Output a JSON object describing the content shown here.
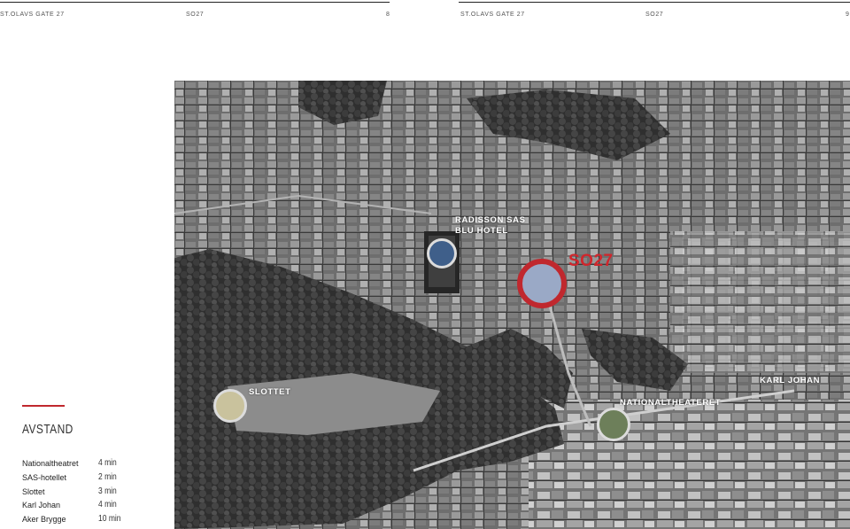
{
  "header_left": {
    "address": "ST.OLAVS GATE 27",
    "brand": "SO27",
    "page": "8"
  },
  "header_right": {
    "address": "ST.OLAVS GATE 27",
    "brand": "SO27",
    "page": "9"
  },
  "section_title": "AVSTAND",
  "distances": [
    {
      "place": "Nationaltheatret",
      "time": "4 min"
    },
    {
      "place": "SAS-hotellet",
      "time": "2 min"
    },
    {
      "place": "Slottet",
      "time": "3 min"
    },
    {
      "place": "Karl Johan",
      "time": "4 min"
    },
    {
      "place": "Aker Brygge",
      "time": "10 min"
    }
  ],
  "map": {
    "labels": {
      "radisson_line1": "RADISSON SAS",
      "radisson_line2": "BLU HOTEL",
      "so27": "SO27",
      "slottet": "SLOTTET",
      "karl_johan": "KARL JOHAN",
      "nationaltheateret": "NATIONALTHEATERET"
    },
    "colors": {
      "accent": "#c0282e"
    }
  }
}
